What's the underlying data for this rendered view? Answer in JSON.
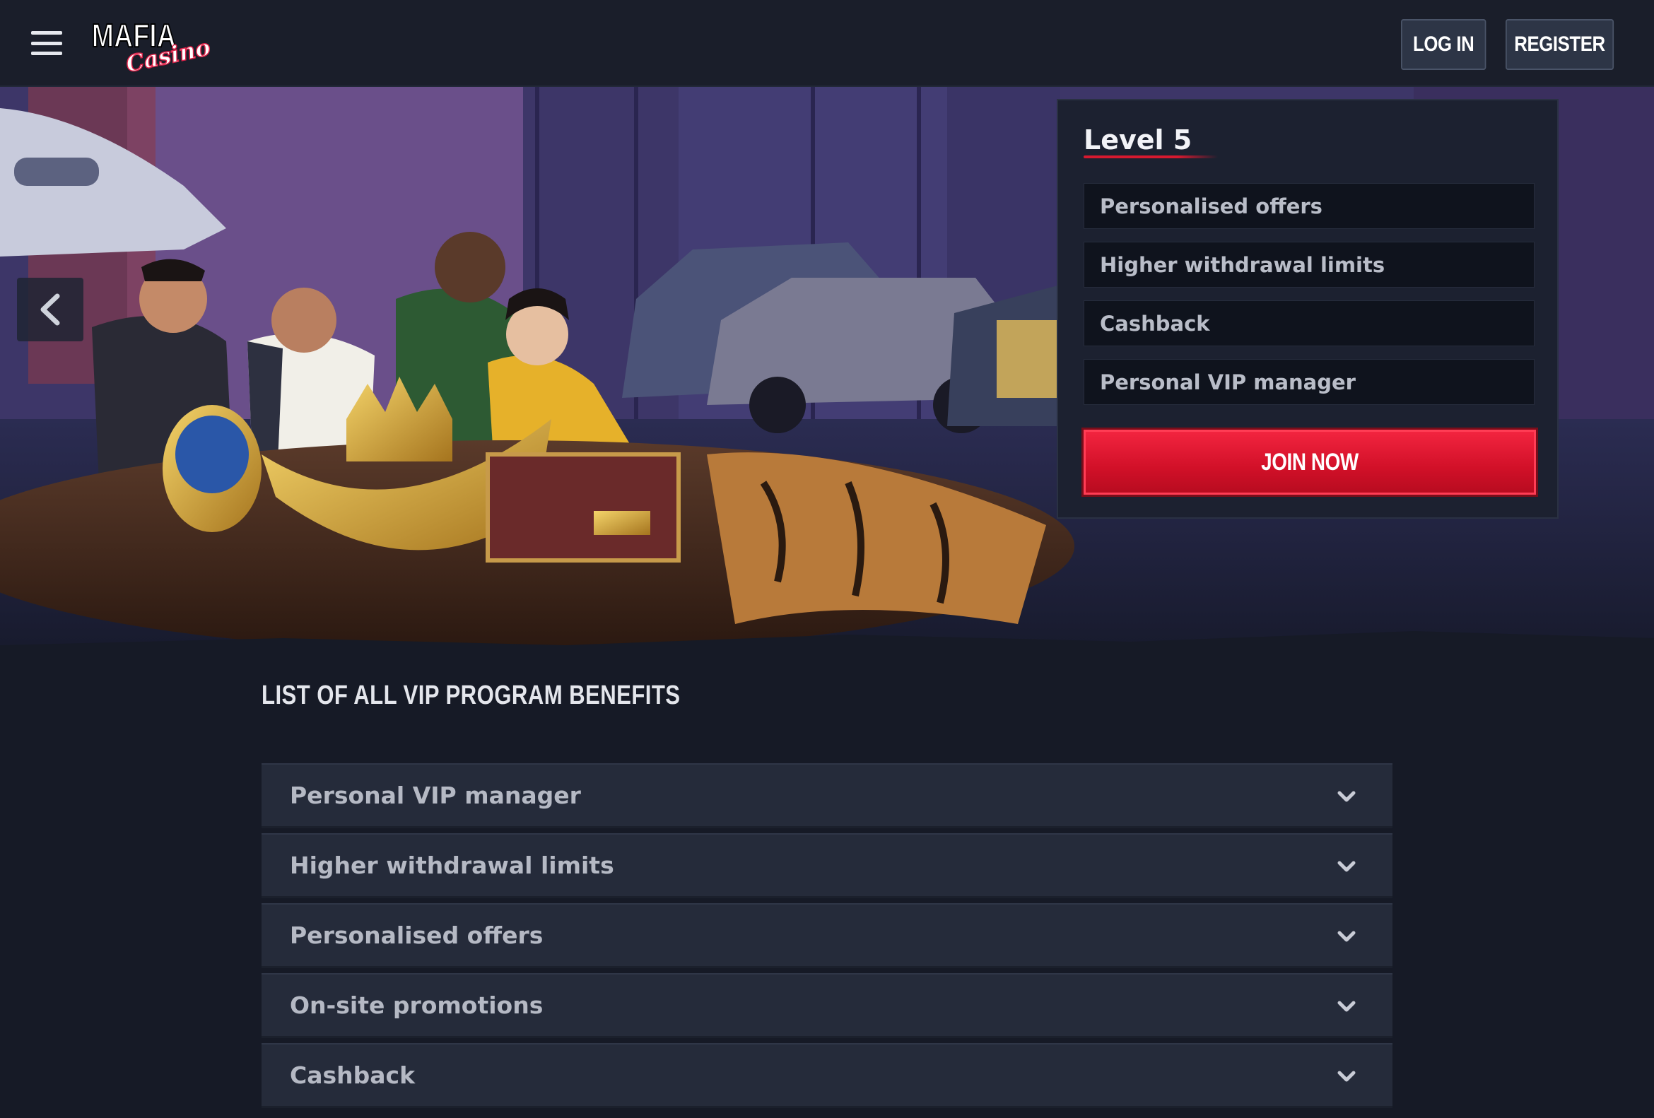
{
  "header": {
    "logo_alt": "Mafia Casino",
    "logo_word_main": "MAFIA",
    "logo_word_script": "Casino",
    "login_label": "LOG IN",
    "register_label": "REGISTER"
  },
  "hero": {
    "level_title": "Level 5",
    "perks": [
      "Personalised offers",
      "Higher withdrawal limits",
      "Cashback",
      "Personal VIP manager"
    ],
    "join_label": "JOIN NOW"
  },
  "benefits": {
    "title": "LIST OF ALL VIP PROGRAM BENEFITS",
    "items": [
      "Personal VIP manager",
      "Higher withdrawal limits",
      "Personalised offers",
      "On-site promotions",
      "Cashback"
    ]
  },
  "icons": {
    "menu": "hamburger-menu-icon",
    "prev": "chevron-left-icon",
    "expand": "chevron-down-icon"
  },
  "colors": {
    "accent_red": "#d6192f",
    "background": "#161a26",
    "panel": "#1c2130"
  }
}
